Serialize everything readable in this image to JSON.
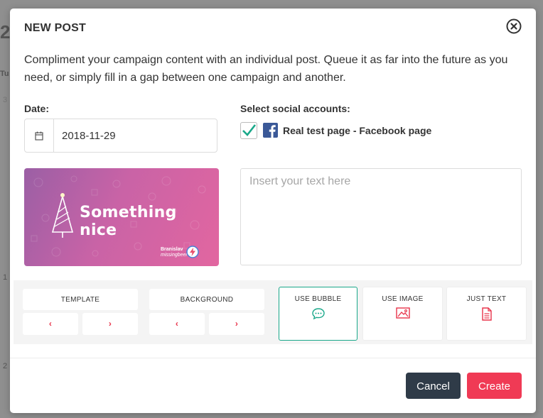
{
  "modal": {
    "title": "NEW POST",
    "intro": "Compliment your campaign content with an individual post. Queue it as far into the future as you need, or simply fill in a gap between one campaign and another."
  },
  "date": {
    "label": "Date:",
    "value": "2018-11-29",
    "icon": "calendar-icon"
  },
  "accounts": {
    "label": "Select social accounts:",
    "items": [
      {
        "name": "Real test page - Facebook page",
        "checked": true,
        "icon": "facebook-icon"
      }
    ]
  },
  "preview": {
    "text": "Something nice",
    "brand_line1": "Branislav",
    "brand_line2": "missingbeer"
  },
  "post_text": {
    "placeholder": "Insert your text here",
    "value": ""
  },
  "toolbar": {
    "template": {
      "label": "TEMPLATE",
      "prev": "‹",
      "next": "›"
    },
    "background": {
      "label": "BACKGROUND",
      "prev": "‹",
      "next": "›"
    },
    "options": [
      {
        "label": "USE BUBBLE",
        "icon": "chat-bubble-icon",
        "active": true
      },
      {
        "label": "USE IMAGE",
        "icon": "image-icon",
        "active": false
      },
      {
        "label": "JUST TEXT",
        "icon": "document-icon",
        "active": false
      }
    ]
  },
  "buttons": {
    "cancel": "Cancel",
    "create": "Create"
  },
  "colors": {
    "accent_red": "#f03a55",
    "dark_button": "#2f3b48",
    "active_green": "#1aa88a",
    "facebook_blue": "#3b5998"
  }
}
